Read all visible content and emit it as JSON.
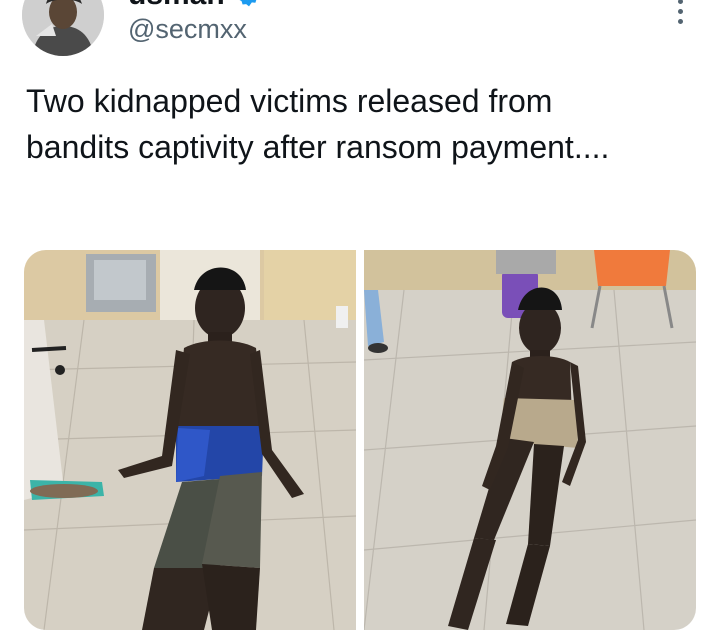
{
  "tweet": {
    "author": {
      "display_name": "usman",
      "handle": "@secmxx",
      "verified_icon": "verified-badge-icon"
    },
    "text": "Two kidnapped victims released from bandits captivity after ransom payment....",
    "media": [
      {
        "kind": "photo",
        "subject": "person-seated-blue-shorts"
      },
      {
        "kind": "photo",
        "subject": "person-seated-floor"
      }
    ],
    "more_icon": "more-vertical-icon",
    "accent": "#1d9bf0"
  }
}
